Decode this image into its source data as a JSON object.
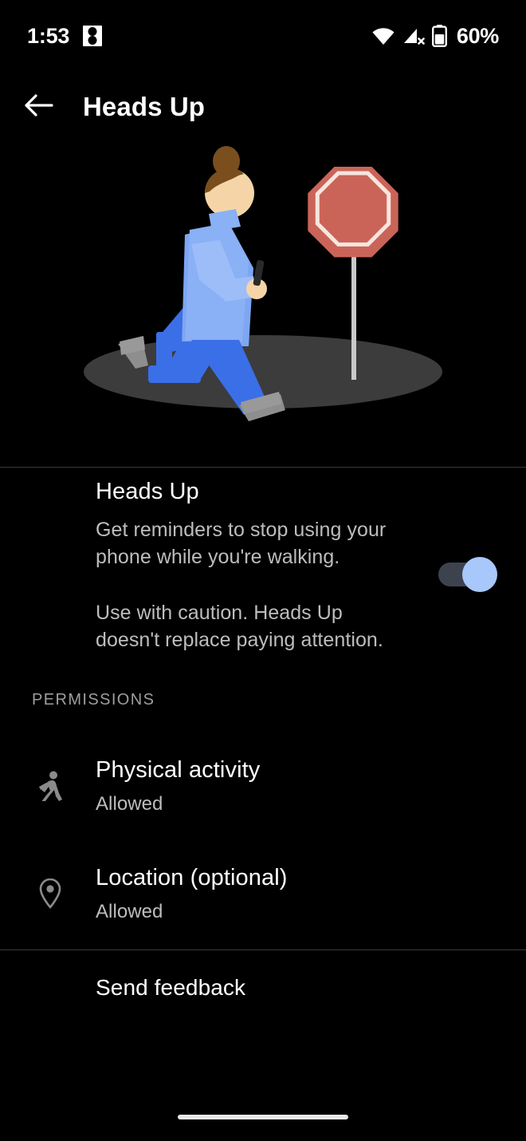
{
  "status_bar": {
    "time": "1:53",
    "notification_icon": "two-dot-square-icon",
    "wifi_icon": "wifi-icon",
    "cellular_icon": "cellular-off-icon",
    "battery_icon": "battery-icon",
    "battery_percent": "60%"
  },
  "app_bar": {
    "back_icon": "arrow-back-icon",
    "title": "Heads Up"
  },
  "hero": {
    "illustration": "person-walking-looking-at-phone-near-stop-sign",
    "colors": {
      "ground": "#3c3c3c",
      "shirt": "#8ab0f5",
      "pants": "#3b6fe8",
      "skin": "#f5d5a8",
      "hair": "#7a4f1d",
      "shoe": "#9a9a9a",
      "sign_fill": "#cb6458",
      "sign_border": "#f5e6de",
      "sign_pole": "#c9c9c9"
    }
  },
  "main": {
    "title": "Heads Up",
    "description": "Get reminders to stop using your phone while you're walking.",
    "caution": "Use with caution. Heads Up doesn't replace paying attention.",
    "toggle": {
      "name": "heads-up-toggle",
      "state": "on",
      "track_color": "#3c434f",
      "thumb_color": "#a8c7fa"
    }
  },
  "permissions": {
    "section_label": "PERMISSIONS",
    "items": [
      {
        "icon": "running-person-icon",
        "title": "Physical activity",
        "status": "Allowed"
      },
      {
        "icon": "location-pin-icon",
        "title": "Location (optional)",
        "status": "Allowed"
      }
    ]
  },
  "footer": {
    "send_feedback_label": "Send feedback"
  },
  "nav": {
    "home_indicator": "home-indicator-pill"
  }
}
